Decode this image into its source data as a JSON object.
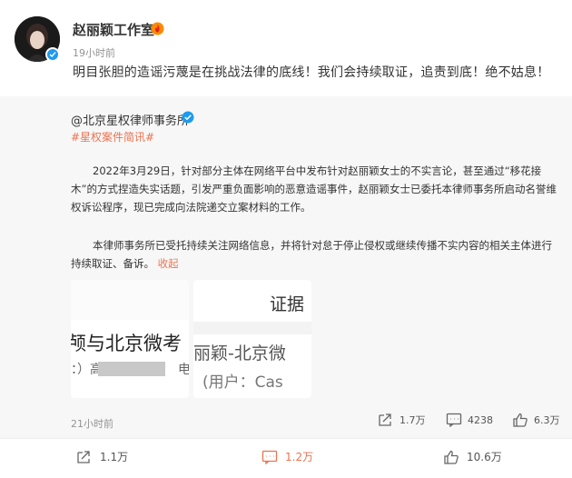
{
  "author": {
    "name": "赵丽颖工作室",
    "time": "19小时前",
    "avatar_icon": "avatar-photo",
    "vip_icon": "fire-badge-icon"
  },
  "post": {
    "text": "明目张胆的造谣污蔑是在挑战法律的底线！我们会持续取证，追责到底！绝不姑息！"
  },
  "repost": {
    "author": "@北京星权律师事务所",
    "hashtag": "#星权案件简讯#",
    "paragraph1": "2022年3月29日，针对部分主体在网络平台中发布针对赵丽颖女士的不实言论，甚至通过“移花接木”的方式捏造失实话题，引发严重负面影响的恶意造谣事件，赵丽颖女士已委托本律师事务所启动名誉维权诉讼程序，现已完成向法院递交立案材料的工作。",
    "paragraph2": "本律师事务所已受托持续关注网络信息，并将针对怠于停止侵权或继续传播不实内容的相关主体进行持续取证、备诉。",
    "collapse_label": "收起",
    "images": [
      {
        "line1": "颅与北京微考",
        "line2": "：）高均",
        "line2b": "电"
      },
      {
        "line0": "证据",
        "line1": "丽颖-北京微",
        "line2": "(用户：Cas"
      }
    ],
    "time": "21小时前",
    "reposts": "1.7万",
    "comments": "4238",
    "likes": "6.3万"
  },
  "actions": {
    "repost": "1.1万",
    "comment": "1.2万",
    "like": "10.6万"
  },
  "colors": {
    "accent": "#eb7350",
    "verified": "#1d9bf0",
    "muted": "#939393",
    "repost_bg": "#f7f7f7"
  }
}
